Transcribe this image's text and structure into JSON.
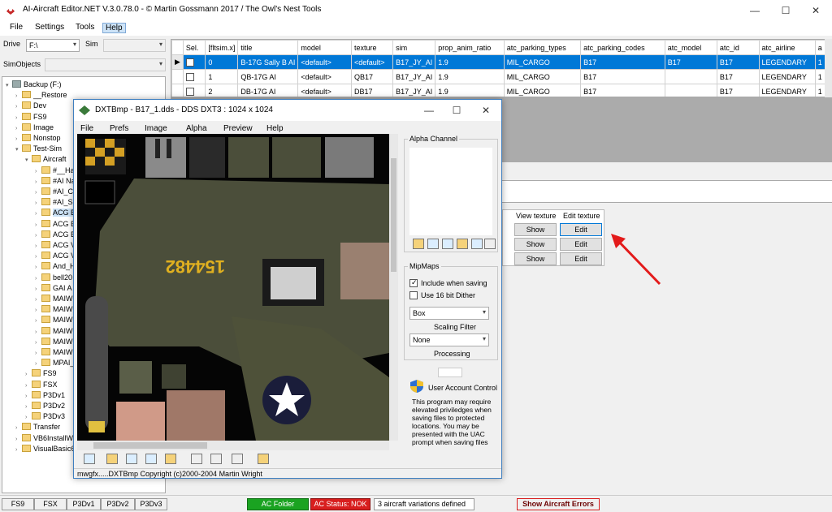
{
  "app": {
    "title": "AI-Aircraft Editor.NET V.3.0.78.0  -  © Martin Gossmann 2017 / The Owl's Nest Tools",
    "min": "—",
    "max": "☐",
    "close": "✕"
  },
  "menu": [
    "File",
    "Settings",
    "Tools",
    "Help"
  ],
  "drive": {
    "label": "Drive",
    "value": "F:\\",
    "sim_label": "Sim",
    "sim_value": ""
  },
  "simobjects": {
    "label": "SimObjects",
    "value": ""
  },
  "tree": [
    {
      "label": "Backup (F:)",
      "level": 0,
      "exp": "▾",
      "icon": "drive-icon"
    },
    {
      "label": "__Restore",
      "level": 1,
      "exp": "›"
    },
    {
      "label": "Dev",
      "level": 1,
      "exp": "›"
    },
    {
      "label": "FS9",
      "level": 1,
      "exp": "›"
    },
    {
      "label": "Image",
      "level": 1,
      "exp": "›"
    },
    {
      "label": "Nonstop",
      "level": 1,
      "exp": "›"
    },
    {
      "label": "Test-Sim",
      "level": 1,
      "exp": "▾"
    },
    {
      "label": "Aircraft",
      "level": 2,
      "exp": "▾"
    },
    {
      "label": "#__Ha",
      "level": 3,
      "exp": "›"
    },
    {
      "label": "#AI Na",
      "level": 3,
      "exp": "›"
    },
    {
      "label": "#AI_C",
      "level": 3,
      "exp": "›"
    },
    {
      "label": "#AI_S",
      "level": 3,
      "exp": "›"
    },
    {
      "label": "ACG B",
      "level": 3,
      "exp": "›",
      "selected": true
    },
    {
      "label": "ACG B",
      "level": 3,
      "exp": "›"
    },
    {
      "label": "ACG B",
      "level": 3,
      "exp": "›"
    },
    {
      "label": "ACG V",
      "level": 3,
      "exp": "›"
    },
    {
      "label": "ACG V",
      "level": 3,
      "exp": "›"
    },
    {
      "label": "And_H",
      "level": 3,
      "exp": "›"
    },
    {
      "label": "bell20",
      "level": 3,
      "exp": "›"
    },
    {
      "label": "GAI A",
      "level": 3,
      "exp": "›"
    },
    {
      "label": "MAIW",
      "level": 3,
      "exp": "›"
    },
    {
      "label": "MAIW",
      "level": 3,
      "exp": "›"
    },
    {
      "label": "MAIW",
      "level": 3,
      "exp": "›"
    },
    {
      "label": "MAIW",
      "level": 3,
      "exp": "›"
    },
    {
      "label": "MAIW",
      "level": 3,
      "exp": "›"
    },
    {
      "label": "MAIW",
      "level": 3,
      "exp": "›"
    },
    {
      "label": "MPAI_",
      "level": 3,
      "exp": "›"
    },
    {
      "label": "FS9",
      "level": 2,
      "exp": "›"
    },
    {
      "label": "FSX",
      "level": 2,
      "exp": "›"
    },
    {
      "label": "P3Dv1",
      "level": 2,
      "exp": "›"
    },
    {
      "label": "P3Dv2",
      "level": 2,
      "exp": "›"
    },
    {
      "label": "P3Dv3",
      "level": 2,
      "exp": "›"
    },
    {
      "label": "Transfer",
      "level": 1,
      "exp": "›"
    },
    {
      "label": "VB6InstallWor",
      "level": 1,
      "exp": "›"
    },
    {
      "label": "VisualBasic6",
      "level": 1,
      "exp": "›"
    }
  ],
  "grid": {
    "columns": [
      "Sel.",
      "[fltsim.x]",
      "title",
      "model",
      "texture",
      "sim",
      "prop_anim_ratio",
      "atc_parking_types",
      "atc_parking_codes",
      "atc_model",
      "atc_id",
      "atc_airline",
      "a"
    ],
    "rows": [
      [
        "",
        "0",
        "B-17G Sally B AI",
        "<default>",
        "<default>",
        "B17_JY_AI",
        "1.9",
        "MIL_CARGO",
        "B17",
        "B17",
        "B17",
        "LEGENDARY",
        "1"
      ],
      [
        "",
        "1",
        "QB-17G AI",
        "<default>",
        "QB17",
        "B17_JY_AI",
        "1.9",
        "MIL_CARGO",
        "B17",
        "",
        "B17",
        "LEGENDARY",
        "1"
      ],
      [
        "",
        "2",
        "DB-17G AI",
        "<default>",
        "DB17",
        "B17_JY_AI",
        "1.9",
        "MIL_CARGO",
        "B17",
        "",
        "B17",
        "LEGENDARY",
        "1"
      ]
    ]
  },
  "texgrid": {
    "h1": "View texture",
    "h2": "Edit texture",
    "show": "Show",
    "edit": "Edit"
  },
  "dxt": {
    "title": "DXTBmp - B17_1.dds - DDS DXT3 : 1024 x 1024",
    "menu": [
      "File",
      "Prefs",
      "Image",
      "Alpha",
      "Preview",
      "Help"
    ],
    "serial": "154482",
    "alpha_label": "Alpha Channel",
    "mipmaps_label": "MipMaps",
    "include": "Include when saving",
    "dither": "Use 16 bit Dither",
    "filter_value": "Box",
    "filter_label": "Scaling Filter",
    "proc_value": "None",
    "proc_label": "Processing",
    "uac_title": "User Account Control",
    "uac_text": "This program may require elevated priviledges when saving files to protected locations. You may be presented with the UAC prompt when saving files",
    "footer": "mwgfx.....DXTBmp Copyright (c)2000-2004 Martin Wright"
  },
  "status": {
    "tabs": [
      "FS9",
      "FSX",
      "P3Dv1",
      "P3Dv2",
      "P3Dv3"
    ],
    "ac_folder": "AC Folder",
    "ac_status": "AC Status: NOK",
    "variations": "3 aircraft variations defined",
    "errors": "Show Aircraft Errors"
  },
  "colors": {
    "select": "#0078d7",
    "ok": "#1aa321",
    "nok": "#d81e1e",
    "ogreen": "#4b4e3a"
  }
}
